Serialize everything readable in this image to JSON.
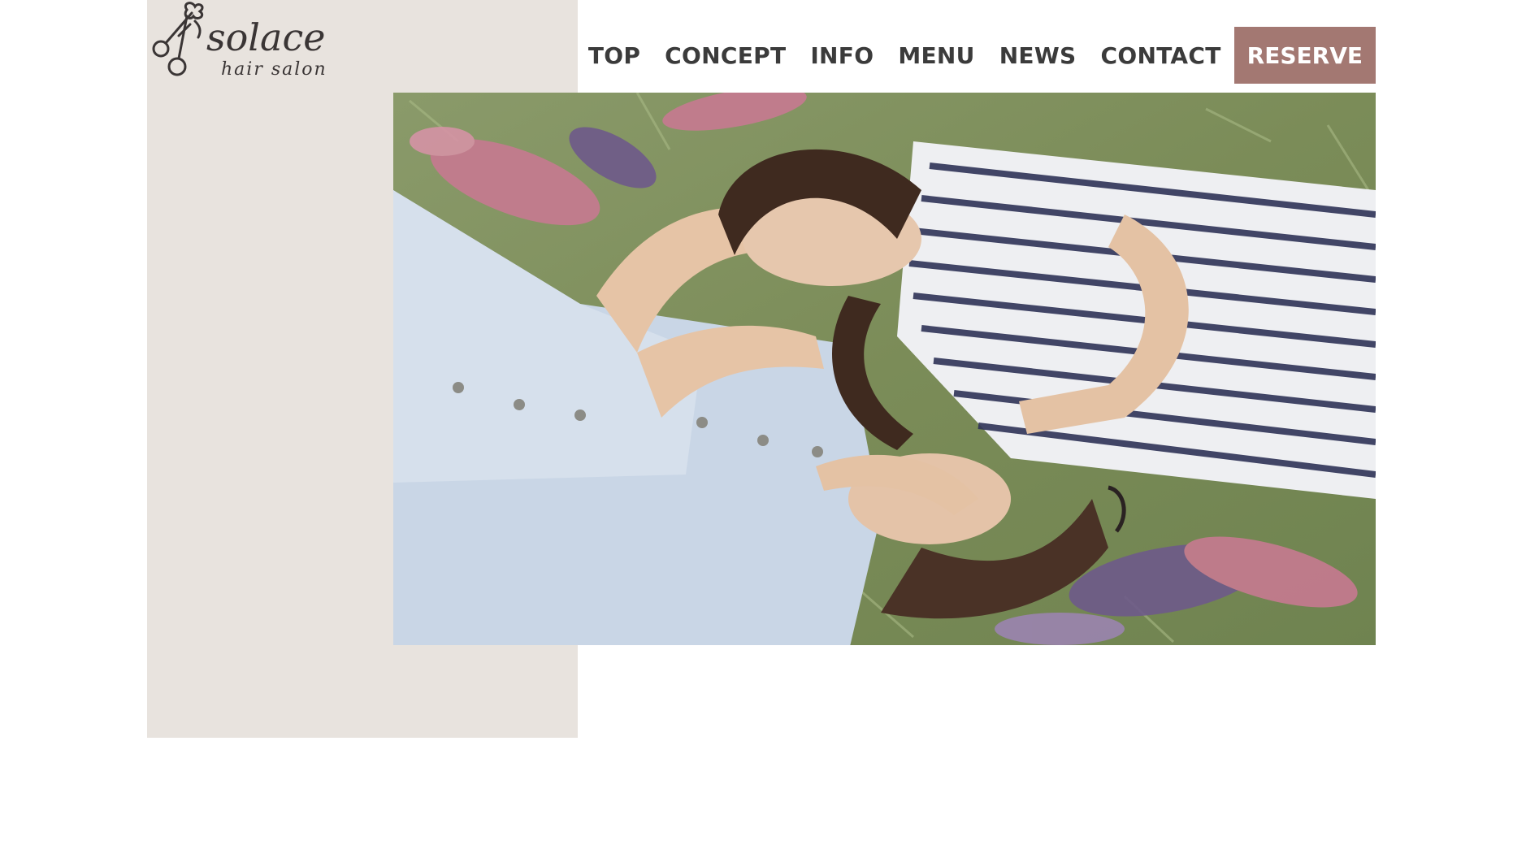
{
  "colors": {
    "panel": "#e8e3de",
    "accent": "#a37872",
    "nav_text": "#3b3b3b",
    "logo_ink": "#3a3535"
  },
  "logo": {
    "name": "solace",
    "tagline": "hair salon",
    "icon": "scissors-flower-icon"
  },
  "nav": {
    "items": [
      {
        "label": "TOP"
      },
      {
        "label": "CONCEPT"
      },
      {
        "label": "INFO"
      },
      {
        "label": "MENU"
      },
      {
        "label": "NEWS"
      },
      {
        "label": "CONTACT"
      }
    ],
    "reserve_label": "RESERVE"
  }
}
